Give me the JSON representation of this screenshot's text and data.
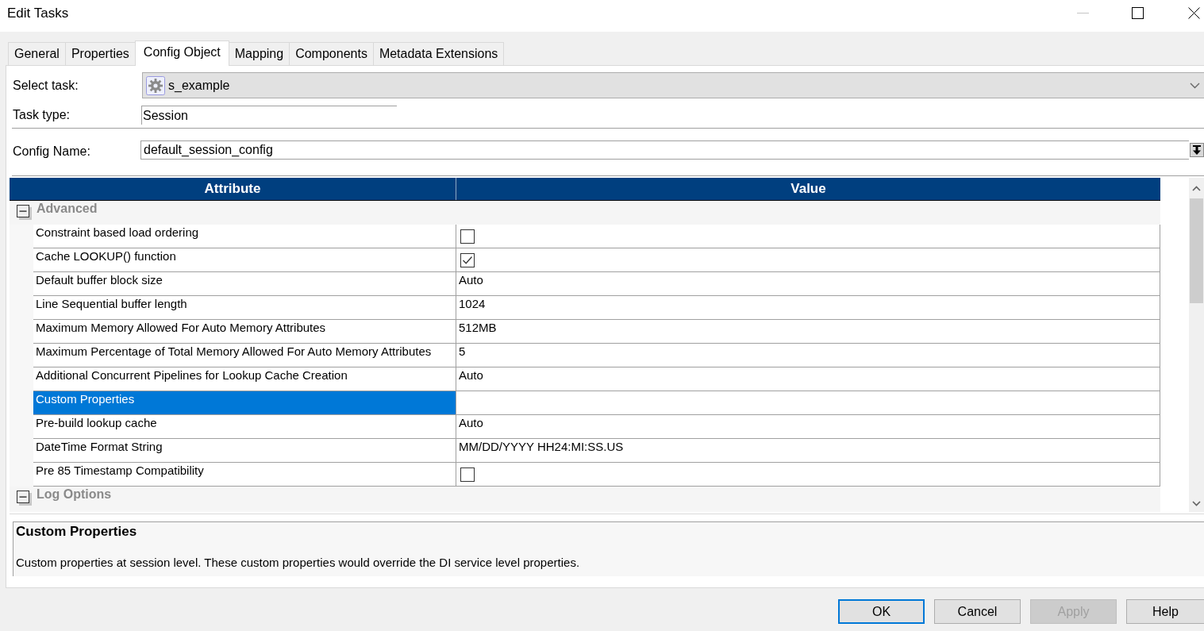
{
  "window": {
    "title": "Edit Tasks"
  },
  "tabs": [
    {
      "label": "General",
      "selected": false
    },
    {
      "label": "Properties",
      "selected": false
    },
    {
      "label": "Config Object",
      "selected": true
    },
    {
      "label": "Mapping",
      "selected": false
    },
    {
      "label": "Components",
      "selected": false
    },
    {
      "label": "Metadata Extensions",
      "selected": false
    }
  ],
  "select_task": {
    "label": "Select task:",
    "value": "s_example"
  },
  "task_type": {
    "label": "Task type:",
    "value": "Session"
  },
  "config_name": {
    "label": "Config Name:",
    "value": "default_session_config"
  },
  "grid": {
    "columns": [
      "Attribute",
      "Value"
    ],
    "groups": [
      {
        "name": "Advanced",
        "expanded": true,
        "rows": [
          {
            "attribute": "Constraint based load ordering",
            "kind": "checkbox",
            "checked": false,
            "selected": false
          },
          {
            "attribute": "Cache LOOKUP() function",
            "kind": "checkbox",
            "checked": true,
            "selected": false
          },
          {
            "attribute": "Default buffer block size",
            "kind": "text",
            "value": "Auto",
            "selected": false
          },
          {
            "attribute": "Line Sequential buffer length",
            "kind": "text",
            "value": "1024",
            "selected": false
          },
          {
            "attribute": "Maximum Memory Allowed For Auto Memory Attributes",
            "kind": "text",
            "value": "512MB",
            "selected": false
          },
          {
            "attribute": "Maximum Percentage of Total Memory Allowed For Auto Memory Attributes",
            "kind": "text",
            "value": "5",
            "selected": false
          },
          {
            "attribute": "Additional Concurrent Pipelines for Lookup Cache Creation",
            "kind": "text",
            "value": "Auto",
            "selected": false
          },
          {
            "attribute": "Custom Properties",
            "kind": "text",
            "selected": true
          },
          {
            "attribute": "Pre-build lookup cache",
            "kind": "text",
            "value": "Auto",
            "selected": false
          },
          {
            "attribute": "DateTime Format String",
            "kind": "text",
            "value": "MM/DD/YYYY HH24:MI:SS.US",
            "selected": false
          },
          {
            "attribute": "Pre 85 Timestamp Compatibility",
            "kind": "checkbox",
            "checked": false,
            "selected": false
          }
        ]
      },
      {
        "name": "Log Options",
        "expanded": true
      }
    ]
  },
  "description": {
    "title": "Custom Properties",
    "text": "Custom properties at session level. These custom properties would override the DI service level properties."
  },
  "buttons": [
    {
      "label": "OK",
      "default": true,
      "disabled": false
    },
    {
      "label": "Cancel",
      "default": false,
      "disabled": false
    },
    {
      "label": "Apply",
      "default": false,
      "disabled": true
    },
    {
      "label": "Help",
      "default": false,
      "disabled": false
    }
  ]
}
